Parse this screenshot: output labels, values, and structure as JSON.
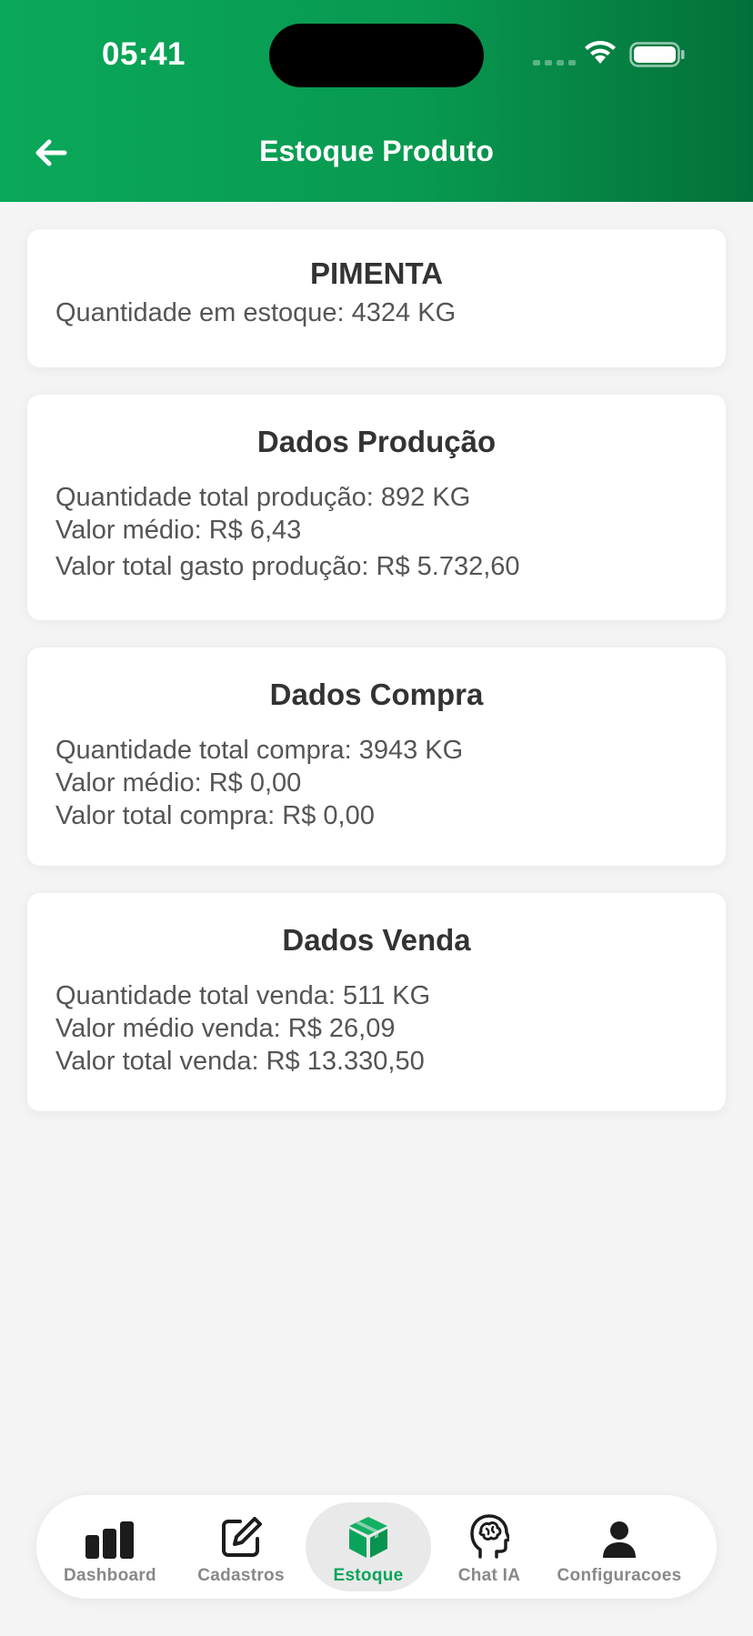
{
  "status_bar": {
    "time": "05:41"
  },
  "header": {
    "title": "Estoque Produto"
  },
  "product": {
    "name": "PIMENTA",
    "stock_line": "Quantidade em estoque: 4324 KG"
  },
  "production": {
    "title": "Dados Produção",
    "total_qty": "Quantidade total produção: 892 KG",
    "avg_value": "Valor médio: R$ 6,43",
    "total_spent": "Valor total gasto produção: R$ 5.732,60"
  },
  "purchase": {
    "title": "Dados Compra",
    "total_qty": "Quantidade total compra: 3943 KG",
    "avg_value": "Valor médio: R$ 0,00",
    "total_value": "Valor total compra: R$ 0,00"
  },
  "sales": {
    "title": "Dados Venda",
    "total_qty": "Quantidade total venda: 511 KG",
    "avg_value": "Valor médio venda: R$ 26,09",
    "total_value": "Valor total venda: R$ 13.330,50"
  },
  "nav": {
    "items": [
      {
        "label": "Dashboard",
        "icon": "bar-chart-icon"
      },
      {
        "label": "Cadastros",
        "icon": "edit-icon"
      },
      {
        "label": "Estoque",
        "icon": "box-icon",
        "active": true
      },
      {
        "label": "Chat IA",
        "icon": "brain-head-icon"
      },
      {
        "label": "Configuracoes",
        "icon": "user-icon"
      }
    ]
  },
  "colors": {
    "brand_green": "#0aa85a",
    "brand_green_dark": "#03703a",
    "active_label": "#0aa35a"
  }
}
